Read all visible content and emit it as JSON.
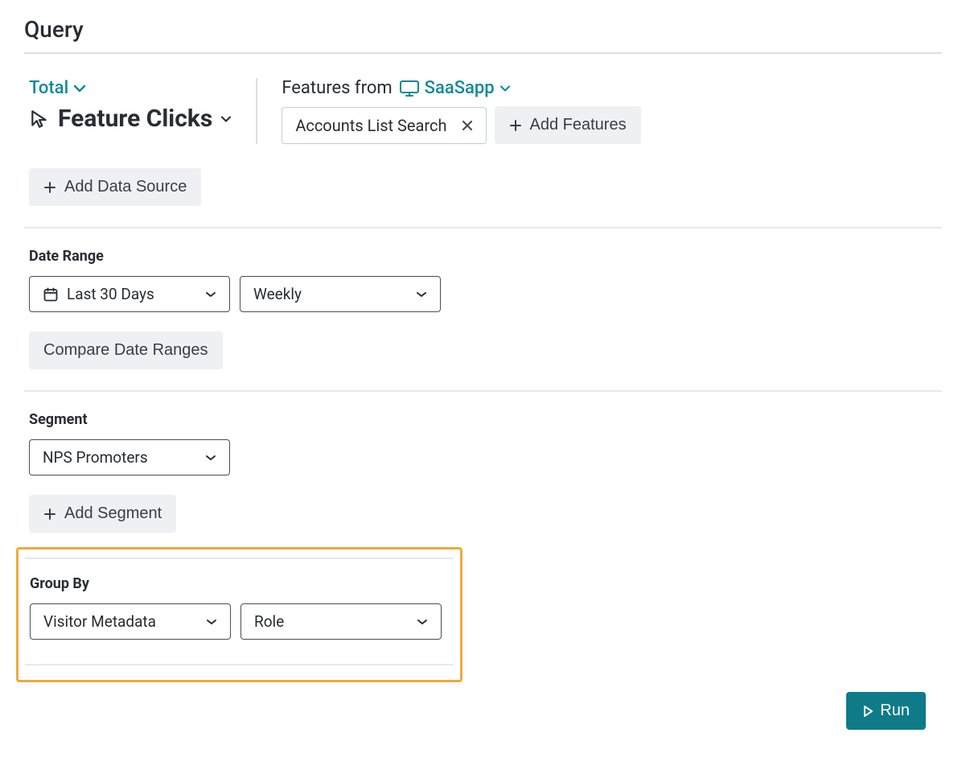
{
  "header": {
    "title": "Query"
  },
  "data_source": {
    "aggregation": "Total",
    "metric": "Feature Clicks",
    "features_from_label": "Features from",
    "app_name": "SaaSapp",
    "selected_feature": "Accounts List Search",
    "add_features_label": "Add Features",
    "add_data_source_label": "Add Data Source"
  },
  "date_range": {
    "label": "Date Range",
    "range": "Last 30 Days",
    "granularity": "Weekly",
    "compare_label": "Compare Date Ranges"
  },
  "segment": {
    "label": "Segment",
    "value": "NPS Promoters",
    "add_label": "Add Segment"
  },
  "group_by": {
    "label": "Group By",
    "source": "Visitor Metadata",
    "field": "Role"
  },
  "actions": {
    "run": "Run"
  }
}
